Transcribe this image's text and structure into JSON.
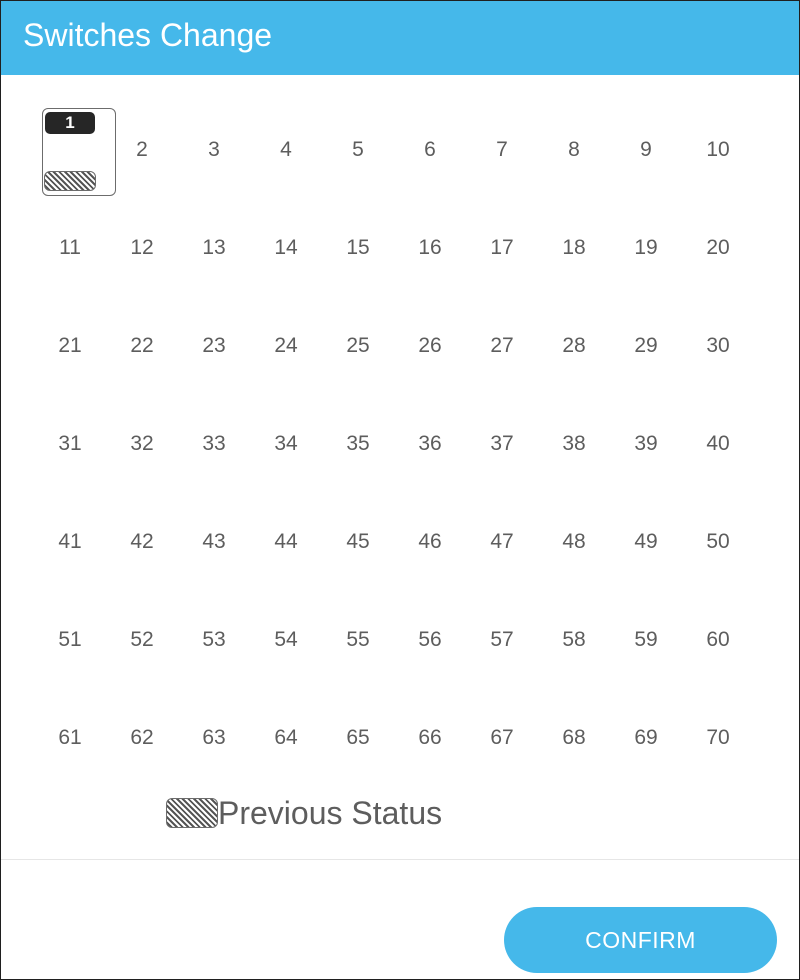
{
  "dialog": {
    "title": "Switches Change",
    "switches": [
      "1",
      "2",
      "3",
      "4",
      "5",
      "6",
      "7",
      "8",
      "9",
      "10",
      "11",
      "12",
      "13",
      "14",
      "15",
      "16",
      "17",
      "18",
      "19",
      "20",
      "21",
      "22",
      "23",
      "24",
      "25",
      "26",
      "27",
      "28",
      "29",
      "30",
      "31",
      "32",
      "33",
      "34",
      "35",
      "36",
      "37",
      "38",
      "39",
      "40",
      "41",
      "42",
      "43",
      "44",
      "45",
      "46",
      "47",
      "48",
      "49",
      "50",
      "51",
      "52",
      "53",
      "54",
      "55",
      "56",
      "57",
      "58",
      "59",
      "60",
      "61",
      "62",
      "63",
      "64",
      "65",
      "66",
      "67",
      "68",
      "69",
      "70"
    ],
    "selected_switch": "1",
    "legend_label": "Previous Status",
    "confirm_label": "CONFIRM"
  },
  "colors": {
    "header": "#45b8ea",
    "button": "#45b8ea",
    "number_text": "#5d5d5d",
    "selected_tag": "#262626"
  }
}
